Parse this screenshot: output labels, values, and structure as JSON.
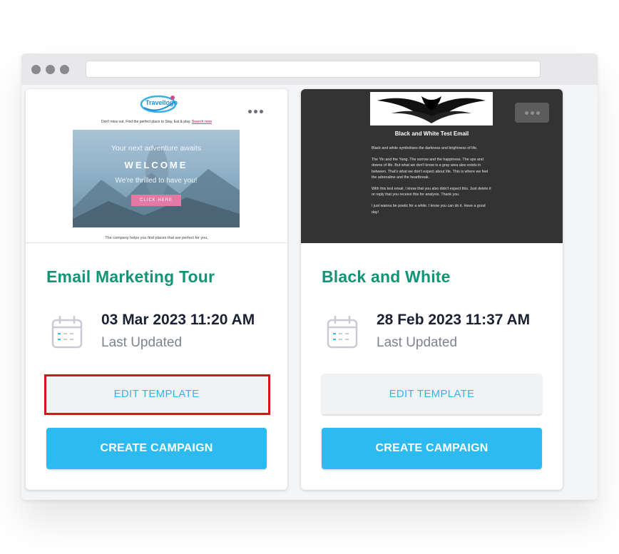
{
  "window": {
    "url": ""
  },
  "colors": {
    "accent_green": "#139477",
    "accent_blue": "#2cbaf0",
    "highlight_red": "#d31717"
  },
  "cards": [
    {
      "title": "Email Marketing Tour",
      "date": "03 Mar 2023 11:20 AM",
      "date_label": "Last Updated",
      "edit_label": "EDIT TEMPLATE",
      "create_label": "CREATE CAMPAIGN",
      "preview": {
        "logo": "Travellogo",
        "tagline": "Don't miss out. Find the perfect place to Stay, Eat & play.",
        "tagline_link": "Search now",
        "hero_sub": "Your next adventure awaits",
        "hero_title": "WELCOME",
        "hero_text": "We're thrilled to have you!",
        "hero_button": "CLICK HERE",
        "body_line": "The company helps you find places that are perfect for you,"
      }
    },
    {
      "title": "Black and White",
      "date": "28 Feb 2023 11:37 AM",
      "date_label": "Last Updated",
      "edit_label": "EDIT TEMPLATE",
      "create_label": "CREATE CAMPAIGN",
      "preview": {
        "heading": "Black and White Test Email",
        "para1": "Black and white symbolises the darkness and brightness of life.",
        "para2": "The Yin and the Yang. The sorrow and the happiness. The ups and downs of life. But what we don't know is a gray area also exists in between. That's what we don't expect about life. This is where we feel the adrenaline and the heartbreak.",
        "para3": "With this test email, I know that you also didn't expect this. Just delete it or reply that you receive this for analysis. Thank you.",
        "para4": "I just wanna be poetic for a while. I know you can do it. Have a good day!"
      }
    }
  ]
}
